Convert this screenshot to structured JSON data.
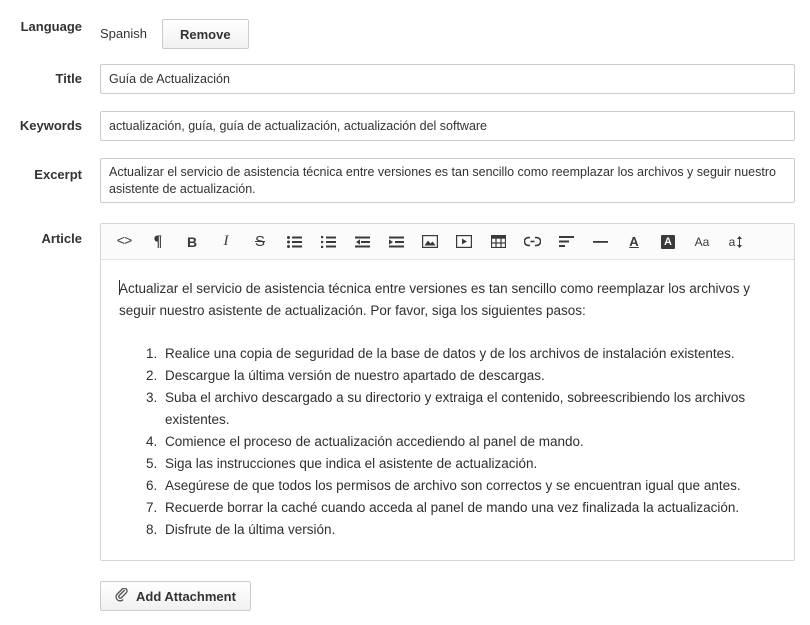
{
  "fields": {
    "language": {
      "label": "Language",
      "value": "Spanish",
      "remove_label": "Remove"
    },
    "title": {
      "label": "Title",
      "value": "Guía de Actualización",
      "placeholder": ""
    },
    "keywords": {
      "label": "Keywords",
      "value": "actualización, guía, guía de actualización, actualización del software",
      "placeholder": ""
    },
    "excerpt": {
      "label": "Excerpt",
      "value": "Actualizar el servicio de asistencia técnica entre versiones es tan sencillo como reemplazar los archivos y seguir nuestro asistente de actualización.",
      "placeholder": ""
    },
    "article": {
      "label": "Article"
    }
  },
  "toolbar": {
    "buttons": [
      {
        "name": "source-code-icon",
        "glyph": "<>",
        "title": "Code view"
      },
      {
        "name": "paragraph-icon",
        "glyph": "¶",
        "title": "Paragraph"
      },
      {
        "name": "bold-icon",
        "glyph": "B",
        "title": "Bold"
      },
      {
        "name": "italic-icon",
        "glyph": "I",
        "title": "Italic"
      },
      {
        "name": "strikethrough-icon",
        "glyph": "S",
        "title": "Strikethrough"
      },
      {
        "name": "unordered-list-icon",
        "glyph": "",
        "title": "Unordered list"
      },
      {
        "name": "ordered-list-icon",
        "glyph": "",
        "title": "Ordered list"
      },
      {
        "name": "outdent-icon",
        "glyph": "",
        "title": "Outdent"
      },
      {
        "name": "indent-icon",
        "glyph": "",
        "title": "Indent"
      },
      {
        "name": "image-icon",
        "glyph": "",
        "title": "Insert image"
      },
      {
        "name": "video-icon",
        "glyph": "",
        "title": "Insert video"
      },
      {
        "name": "table-icon",
        "glyph": "",
        "title": "Insert table"
      },
      {
        "name": "link-icon",
        "glyph": "",
        "title": "Insert link"
      },
      {
        "name": "align-icon",
        "glyph": "",
        "title": "Align"
      },
      {
        "name": "horizontal-rule-icon",
        "glyph": "—",
        "title": "Horizontal line"
      },
      {
        "name": "text-color-icon",
        "glyph": "A",
        "title": "Text color"
      },
      {
        "name": "highlight-color-icon",
        "glyph": "A",
        "title": "Highlight color"
      },
      {
        "name": "font-size-icon",
        "glyph": "Aa",
        "title": "Font size"
      },
      {
        "name": "line-height-icon",
        "glyph": "a",
        "title": "Line height"
      }
    ]
  },
  "article_body": {
    "intro": "Actualizar el servicio de asistencia técnica entre versiones es tan sencillo como reemplazar los archivos y seguir nuestro asistente de actualización. Por favor, siga los siguientes pasos:",
    "steps": [
      "Realice una copia de seguridad de la base de datos y de los archivos de instalación existentes.",
      "Descargue la última versión de nuestro apartado de descargas.",
      "Suba el archivo descargado a su directorio y extraiga el contenido, sobreescribiendo los archivos existentes.",
      "Comience el proceso de actualización accediendo al panel de mando.",
      "Siga las instrucciones que indica el asistente de actualización.",
      "Asegúrese de que todos los permisos de archivo son correctos y se encuentran igual que antes.",
      "Recuerde borrar la caché cuando acceda al panel de mando una vez finalizada la actualización.",
      "Disfrute de la última versión."
    ]
  },
  "attachment": {
    "label": "Add Attachment",
    "icon": "paperclip-icon"
  },
  "colors": {
    "border": "#cccccc",
    "toolbar_bg": "#fbfbfb",
    "text": "#333333",
    "body_text": "#2f2f2f"
  }
}
